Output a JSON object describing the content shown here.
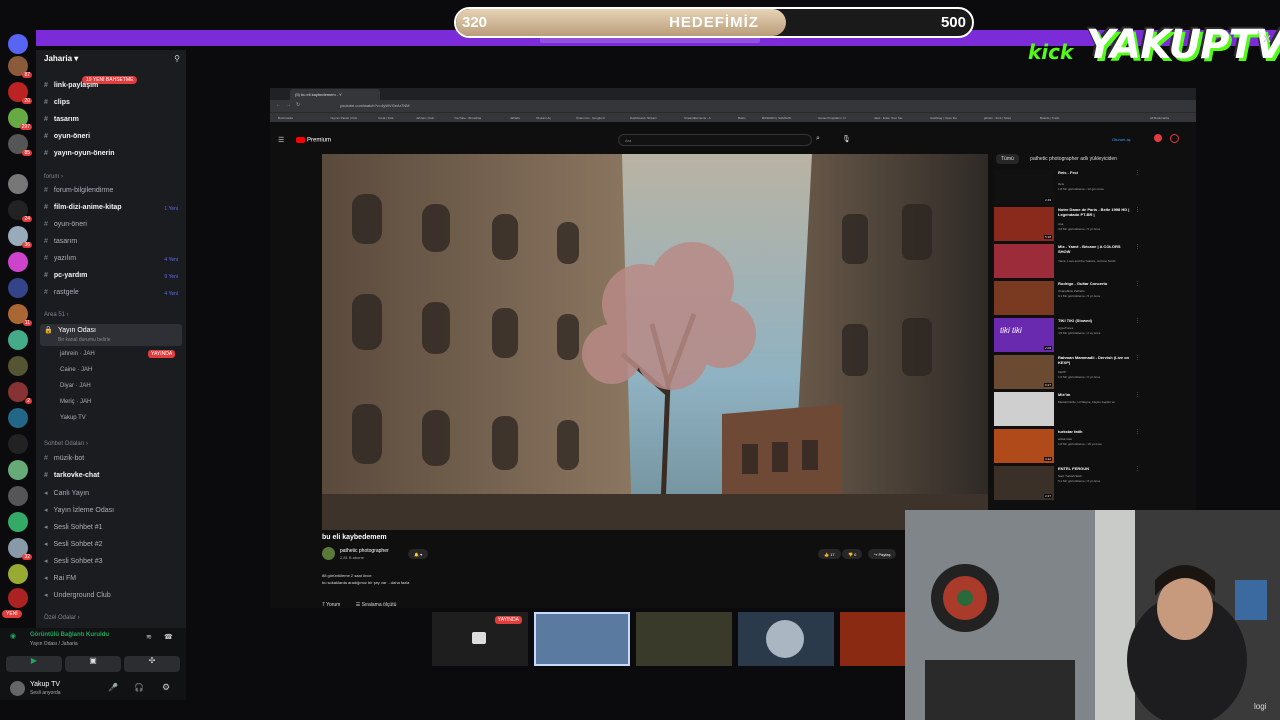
{
  "goal": {
    "current": "320",
    "title": "HEDEFİMİZ",
    "target": "500",
    "progress": 0.64
  },
  "logo": {
    "kick": "kick",
    "name": "YAKUPTV"
  },
  "discord": {
    "server_name": "Jaharia",
    "new_badge": "19 YENİ BAHSETME",
    "channels": [
      {
        "label": "link-paylaşım",
        "bold": true
      },
      {
        "label": "clips",
        "bold": true
      },
      {
        "label": "tasarım",
        "bold": true
      },
      {
        "label": "oyun-öneri",
        "bold": true
      },
      {
        "label": "yayın-oyun-önerin",
        "bold": true
      }
    ],
    "forum_category": "forum",
    "forum_channels": [
      {
        "label": "forum-bilgilendirme",
        "bold": false,
        "count": ""
      },
      {
        "label": "film-dizi-anime-kitap",
        "bold": true,
        "count": "1 Yeni"
      },
      {
        "label": "oyun-öneri",
        "bold": false,
        "count": ""
      },
      {
        "label": "tasarım",
        "bold": false,
        "count": ""
      },
      {
        "label": "yazılım",
        "bold": false,
        "count": "4 Yeni"
      },
      {
        "label": "pc-yardım",
        "bold": true,
        "count": "9 Yeni"
      },
      {
        "label": "rastgele",
        "bold": false,
        "count": "4 Yeni"
      }
    ],
    "area_category": "Area 51",
    "voice_channel": "Yayın Odası",
    "voice_status": "Bir kanal durumu belirle",
    "voice_users": [
      "jahrein",
      "Caine",
      "Diyar",
      "Meriç",
      "Yakup TV"
    ],
    "voice_tag": "JAH",
    "live_label": "YAYINDA",
    "chat_category": "Sohbet Odaları",
    "chat_channels": [
      {
        "label": "müzik-bot",
        "bold": false
      },
      {
        "label": "tarkovke-chat",
        "bold": true
      },
      {
        "label": "Canlı Yayın",
        "bold": false
      },
      {
        "label": "Yayın İzleme Odası",
        "bold": false
      },
      {
        "label": "Sesli Sohbet #1",
        "bold": false
      },
      {
        "label": "Sesli Sohbet #2",
        "bold": false
      },
      {
        "label": "Sesli Sohbet #3",
        "bold": false
      },
      {
        "label": "Rai FM",
        "bold": false
      },
      {
        "label": "Underground Club",
        "bold": false
      }
    ],
    "private_category": "Özel Odalar",
    "connection_status": "Görüntülü Bağlantı Kuruldu",
    "connection_sub": "Yayın Odası / Jaharia",
    "user_name": "Yakup TV",
    "user_status": "Sesli arıyorda",
    "rail_badges": [
      "87",
      "20",
      "297",
      "85",
      "24",
      "36",
      "11",
      "2",
      "32"
    ],
    "rail_new": "YENİ"
  },
  "browser": {
    "tab_title": "(5) bu eli kaybedemem - Y",
    "url": "youtube.com/watch?v=4yWVGeAr7NM",
    "bookmarks": [
      "Bookmarks",
      "Yayıncı Paneli | Kick",
      "Creat | Kick",
      "Jahrein | Kick",
      "YouTube - Broadcas",
      "Jahada",
      "Okuram Aç",
      "Önlem'sm - Google D",
      "Dashboard / Stream",
      "StreamElements - A",
      "Botrix",
      "BUSHIDO | SAMSUN",
      "Günsel Koşulların: N",
      "Jaac - Enter Your Sto",
      "CastSlug | Open the",
      "jahrein - Kick | Strea",
      "Boards | Trello",
      "All Bookmarks"
    ],
    "yt_logo": "Premium",
    "search_placeholder": "Ara",
    "signin": "Oturum aç",
    "video_title": "bu eli kaybedemem",
    "channel_name": "pathetic photographer",
    "channel_subs": "2,81 B abone",
    "likes": "17",
    "dislikes": "0",
    "share": "Paylaş",
    "views": "88 görüntüleme  2 saat önce",
    "description": "bu sokaklarda aradığımız bir şey var ...daha fazla",
    "comments_count": "7 Yorum",
    "sort_label": "Sıralama ölçütü",
    "chips": [
      "Tümü",
      "pathetic photographer adlı yükleyiciden"
    ],
    "recommendations": [
      {
        "title": "Reis - Feci",
        "channel": "Reis",
        "meta": "1,8 Mn görüntüleme • 12 gün önce",
        "duration": "2:49"
      },
      {
        "title": "Notre Dame de Paris - Belle 1998 HD | Legendado PT-BR |",
        "channel": "Ana",
        "meta": "3,6 Mn görüntüleme • 5 yıl önce",
        "duration": "5:18"
      },
      {
        "title": "Mix - Yamê - Bécane | A COLORS SHOW",
        "channel": "Yamê, Lous and the Yakuza, Jerôme Smith",
        "meta": "",
        "duration": ""
      },
      {
        "title": "Rodrigo - Guitar Concerto",
        "channel": "Ovanablinu Zelhetto",
        "meta": "9,1 Mn görüntüleme • 5 yıl önce",
        "duration": ""
      },
      {
        "title": "TIKI TIKI (Slowed)",
        "channel": "HypeTunes",
        "meta": "4,5 Mn görüntüleme • 2 ay önce",
        "duration": "2:03"
      },
      {
        "title": "Rahman Mammadli - Dervish (Live on KEXP)",
        "channel": "KEXP",
        "meta": "1,5 Mn görüntüleme • 6 yıl önce",
        "duration": "6:27"
      },
      {
        "title": "Mix'im",
        "channel": "Mestarimizde, Lil Wayne, Hayko Cepkin ve",
        "meta": "",
        "duration": ""
      },
      {
        "title": "turkstar fatih",
        "channel": "ardek batu",
        "meta": "1,8 Mn görüntüleme • 16 yıl önce",
        "duration": "4:12"
      },
      {
        "title": "ENTEL FERGUN",
        "channel": "Sarp Turkish Web",
        "meta": "5,1 Mn görüntüleme • 8 yıl önce",
        "duration": "2:27"
      }
    ]
  },
  "previews": {
    "live_label": "YAYINDA"
  },
  "webcam_brand": "logi",
  "colors": {
    "accent": "#7c2bd9",
    "kick_green": "#53fc18",
    "live_red": "#e23c3c"
  }
}
